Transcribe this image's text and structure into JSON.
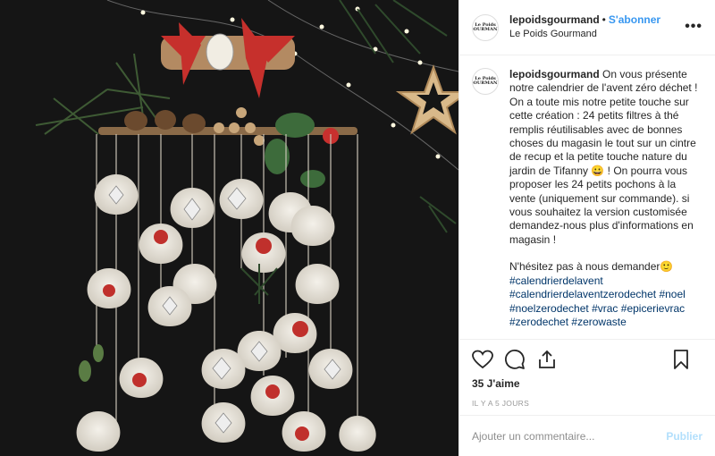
{
  "post": {
    "username": "lepoidsgourmand",
    "separator": "•",
    "follow_label": "S'abonner",
    "location": "Le Poids Gourmand",
    "more_label": "•••",
    "avatar_text": "Le Poids GOURMAND",
    "caption_username": "lepoidsgourmand",
    "caption_text": "On vous présente notre calendrier de l'avent zéro déchet ! On a toute mis notre petite touche sur cette création : 24 petits filtres à thé remplis réutilisables avec de bonnes choses du magasin le tout sur un cintre de recup et la petite touche nature du jardin de Tifanny 😀 ! On pourra vous proposer les 24 petits pochons à la vente (uniquement sur commande). si vous souhaitez la version customisée demandez-nous plus d'informations en magasin !",
    "caption_text2": "N'hésitez pas à nous demander🙂",
    "hashtags": [
      "#calendrierdelavent",
      "#calendrierdelaventzerodechet",
      "#noel",
      "#noelzerodechet",
      "#vrac",
      "#epicerievrac",
      "#zerodechet",
      "#zerowaste"
    ],
    "likes": "35 J'aime",
    "date": "IL Y A 5 JOURS",
    "comment_placeholder": "Ajouter un commentaire...",
    "publish_label": "Publier"
  },
  "icons": {
    "like": "heart-icon",
    "comment": "comment-icon",
    "share": "share-icon",
    "save": "bookmark-icon"
  },
  "colors": {
    "link": "#3897f0",
    "hashtag": "#003569",
    "publish_disabled": "#b2dffc"
  }
}
